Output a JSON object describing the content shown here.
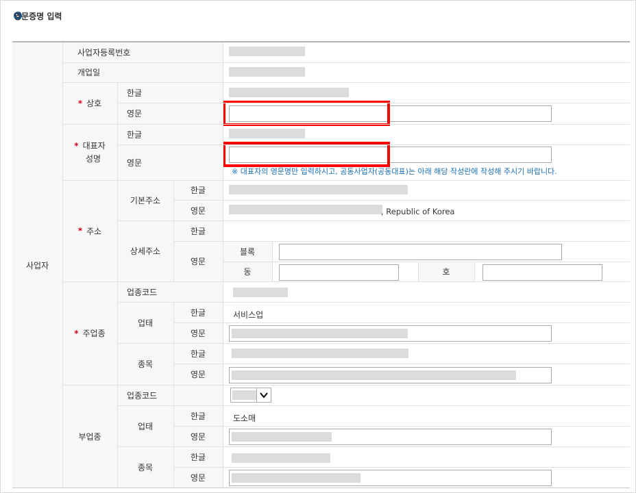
{
  "section_title": "영문증명 입력",
  "labels": {
    "business": "사업자",
    "reg_no": "사업자등록번호",
    "open_date": "개업일",
    "trade_name": "상호",
    "rep_name_1": "대표자",
    "rep_name_2": "성명",
    "address": "주소",
    "basic_address": "기본주소",
    "detail_address": "상세주소",
    "main_biz": "주업종",
    "sub_biz": "부업종",
    "biz_code": "업종코드",
    "biz_type": "업태",
    "biz_item": "종목",
    "korean": "한글",
    "english": "영문",
    "block": "블록",
    "dong": "동",
    "ho": "호"
  },
  "values": {
    "address_country_suffix": ", Republic of Korea",
    "main_biz_type_korean": "서비스업",
    "sub_biz_type_korean": "도소매"
  },
  "required_mark": "*",
  "rep_note": "※ 대표자의 영문명만 입력하시고, 공동사업자(공동대표)는 아래 해당 작성란에 작성해 주시기 바랍니다.",
  "icons": {
    "section": "circle-arrow-icon",
    "select": "chevron-down-icon"
  },
  "colors": {
    "required": "#d0021b",
    "note": "#1a6fb5",
    "highlight": "#ff0000",
    "title_icon": "#1a5fa6"
  }
}
